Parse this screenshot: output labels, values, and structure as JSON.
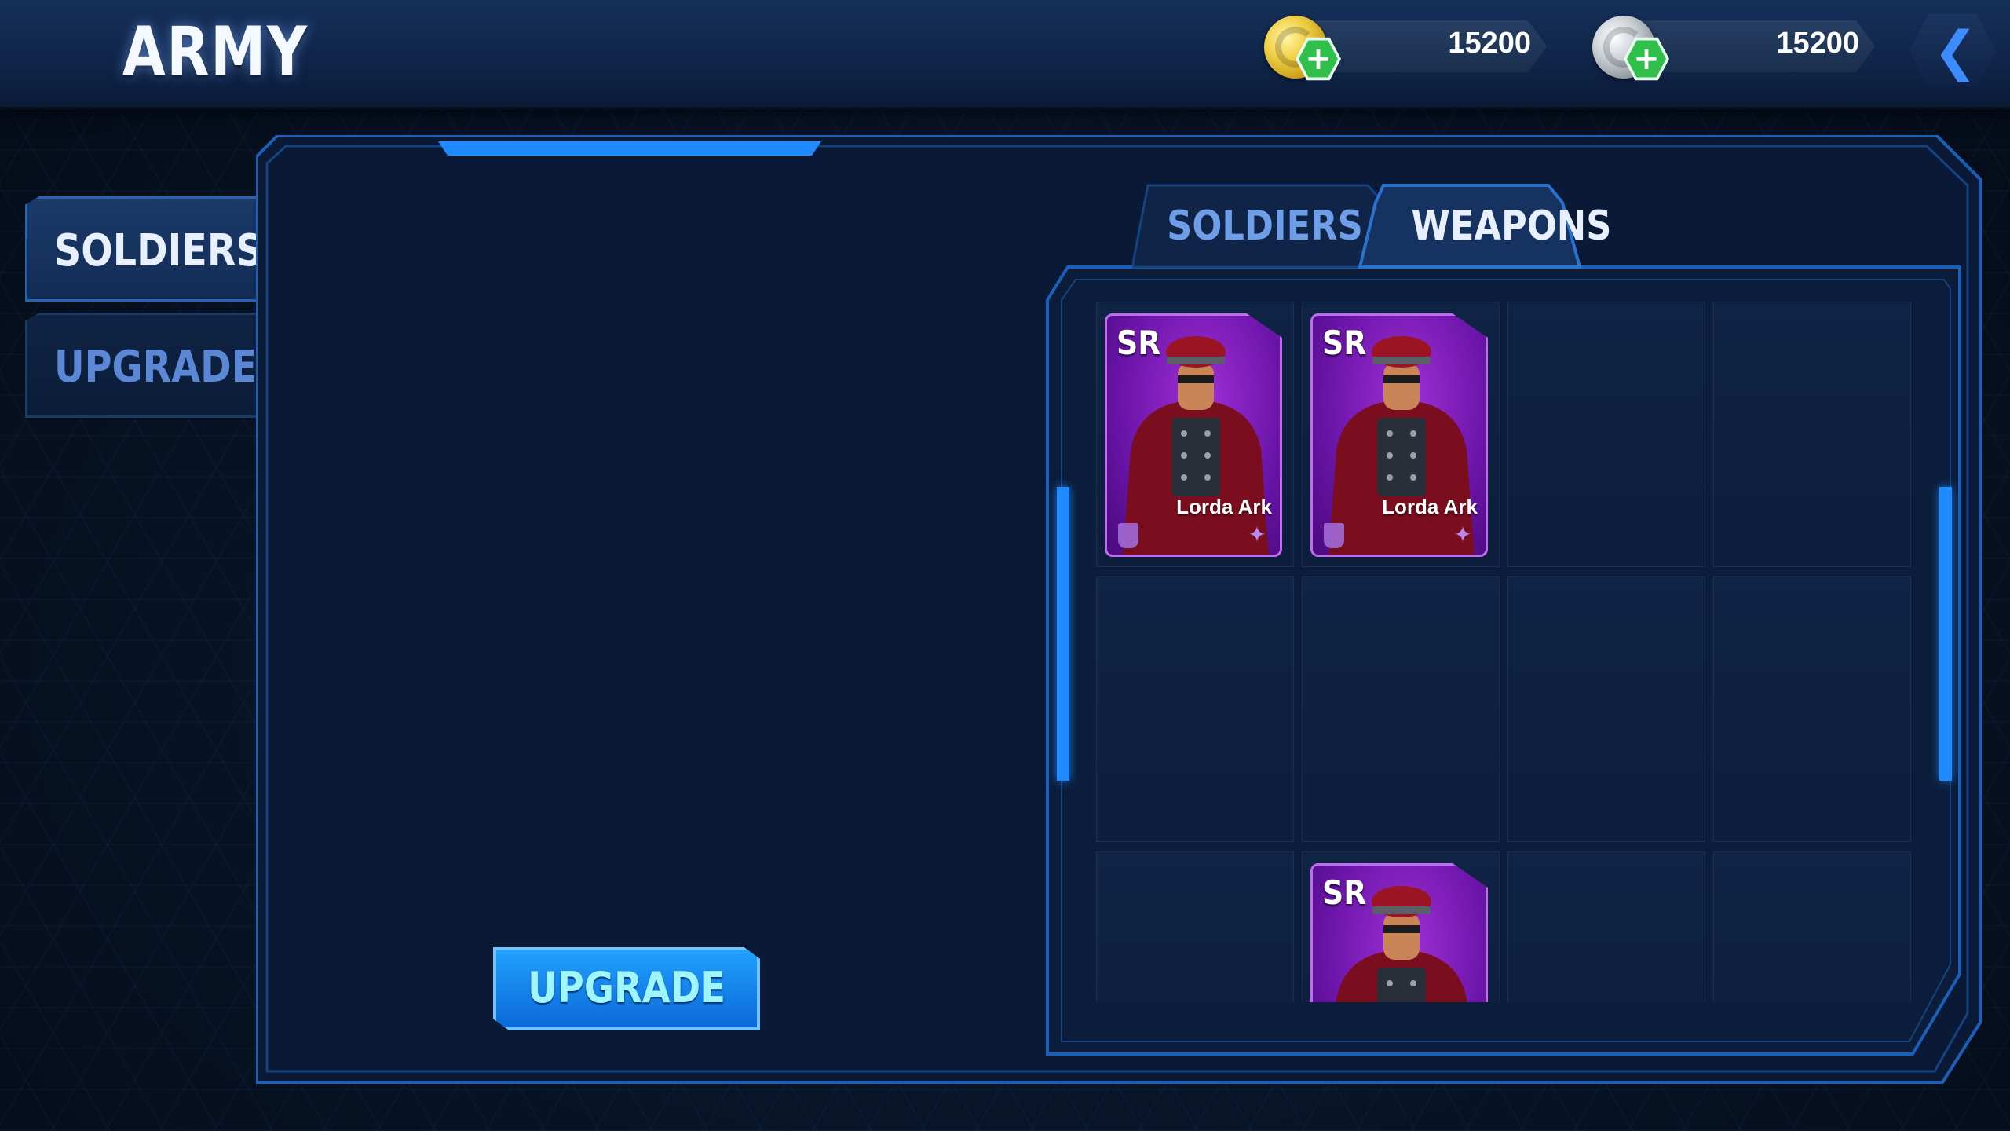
{
  "header": {
    "title": "ARMY",
    "gold": {
      "amount": "15200",
      "icon": "gold-coin-icon",
      "add_icon": "plus-icon"
    },
    "silver": {
      "amount": "15200",
      "icon": "silver-coin-icon",
      "add_icon": "plus-icon"
    },
    "back_icon": "chevron-left-icon"
  },
  "sidebar": {
    "items": [
      {
        "label": "SOLDIERS",
        "active": true
      },
      {
        "label": "UPGRADE",
        "active": false
      }
    ]
  },
  "main": {
    "upgrade_button": "UPGRADE",
    "tabs": [
      {
        "label": "SOLDIERS",
        "active": false
      },
      {
        "label": "WEAPONS",
        "active": true
      }
    ],
    "cards": [
      {
        "rarity": "SR",
        "name": "Lorda Ark"
      },
      {
        "rarity": "SR",
        "name": "Lorda Ark"
      },
      {
        "rarity": "SR",
        "name": ""
      }
    ]
  },
  "colors": {
    "accent": "#1f8bff",
    "card_purple": "#6a14a8",
    "tab_active_text": "#e8f0ff",
    "tab_inactive_text": "#5b87d6",
    "button_text": "#9ff6ff"
  }
}
